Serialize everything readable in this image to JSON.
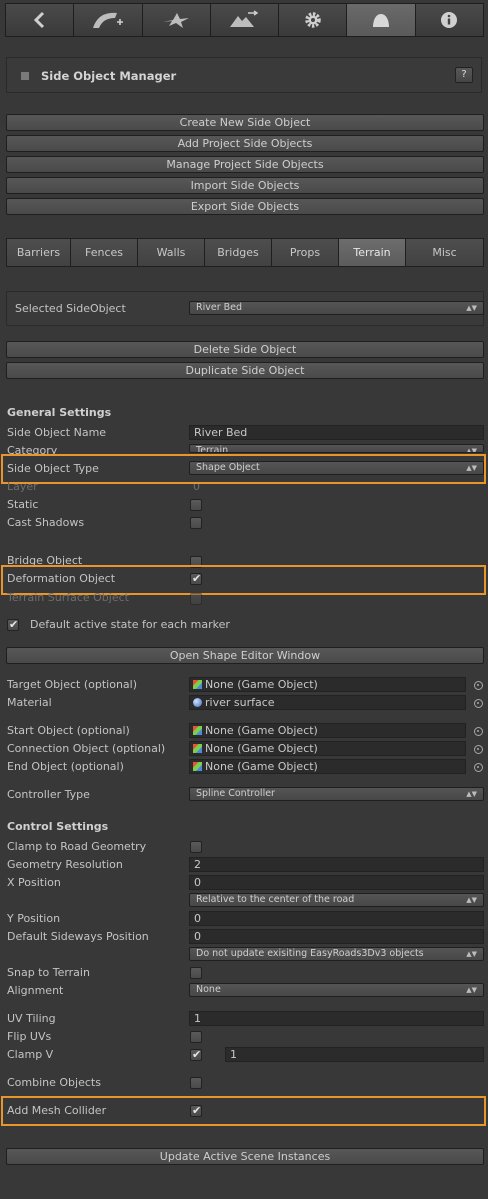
{
  "toolbar": {
    "items": [
      {
        "icon": "back-arrow-icon"
      },
      {
        "icon": "add-road-icon"
      },
      {
        "icon": "crossing-icon"
      },
      {
        "icon": "terrain-road-icon"
      },
      {
        "icon": "gear-icon"
      },
      {
        "icon": "side-object-icon",
        "active": true
      },
      {
        "icon": "info-icon"
      }
    ]
  },
  "header": {
    "title": "Side Object Manager",
    "help": "?"
  },
  "actions": {
    "create": "Create New Side Object",
    "add_project": "Add Project Side Objects",
    "manage_project": "Manage Project Side Objects",
    "import": "Import Side Objects",
    "export": "Export Side Objects"
  },
  "tabs": [
    "Barriers",
    "Fences",
    "Walls",
    "Bridges",
    "Props",
    "Terrain",
    "Misc"
  ],
  "active_tab": "Terrain",
  "selected": {
    "label": "Selected SideObject",
    "value": "River Bed"
  },
  "object_actions": {
    "delete": "Delete Side Object",
    "duplicate": "Duplicate Side Object"
  },
  "general": {
    "title": "General Settings",
    "name_label": "Side Object Name",
    "name_value": "River Bed",
    "category_label": "Category",
    "category_value": "Terrain",
    "type_label": "Side Object Type",
    "type_value": "Shape Object",
    "layer_label": "Layer",
    "layer_value": "0",
    "static_label": "Static",
    "cast_label": "Cast Shadows",
    "bridge_label": "Bridge Object",
    "deformation_label": "Deformation Object",
    "terrain_surface_label": "Terrain Surface Object",
    "default_active_label": "Default active state for each marker",
    "open_shape_editor": "Open Shape Editor Window",
    "target_label": "Target Object (optional)",
    "target_value": "None (Game Object)",
    "material_label": "Material",
    "material_value": "river surface",
    "start_label": "Start Object (optional)",
    "start_value": "None (Game Object)",
    "connection_label": "Connection Object (optional)",
    "connection_value": "None (Game Object)",
    "end_label": "End Object (optional)",
    "end_value": "None (Game Object)",
    "controller_label": "Controller Type",
    "controller_value": "Spline Controller"
  },
  "control": {
    "title": "Control Settings",
    "clamp_label": "Clamp to Road Geometry",
    "resolution_label": "Geometry Resolution",
    "resolution_value": "2",
    "xpos_label": "X Position",
    "xpos_value": "0",
    "relative_value": "Relative to the center of the road",
    "ypos_label": "Y Position",
    "ypos_value": "0",
    "sideways_label": "Default Sideways Position",
    "sideways_value": "0",
    "update_mode_value": "Do not update exisiting EasyRoads3Dv3 objects",
    "snap_label": "Snap to Terrain",
    "alignment_label": "Alignment",
    "alignment_value": "None",
    "uv_label": "UV Tiling",
    "uv_value": "1",
    "flip_label": "Flip UVs",
    "clampv_label": "Clamp V",
    "clampv_value": "1",
    "combine_label": "Combine Objects",
    "collider_label": "Add Mesh Collider",
    "update_button": "Update Active Scene Instances"
  },
  "colors": {
    "highlight": "#e8962b",
    "background": "#383838"
  }
}
